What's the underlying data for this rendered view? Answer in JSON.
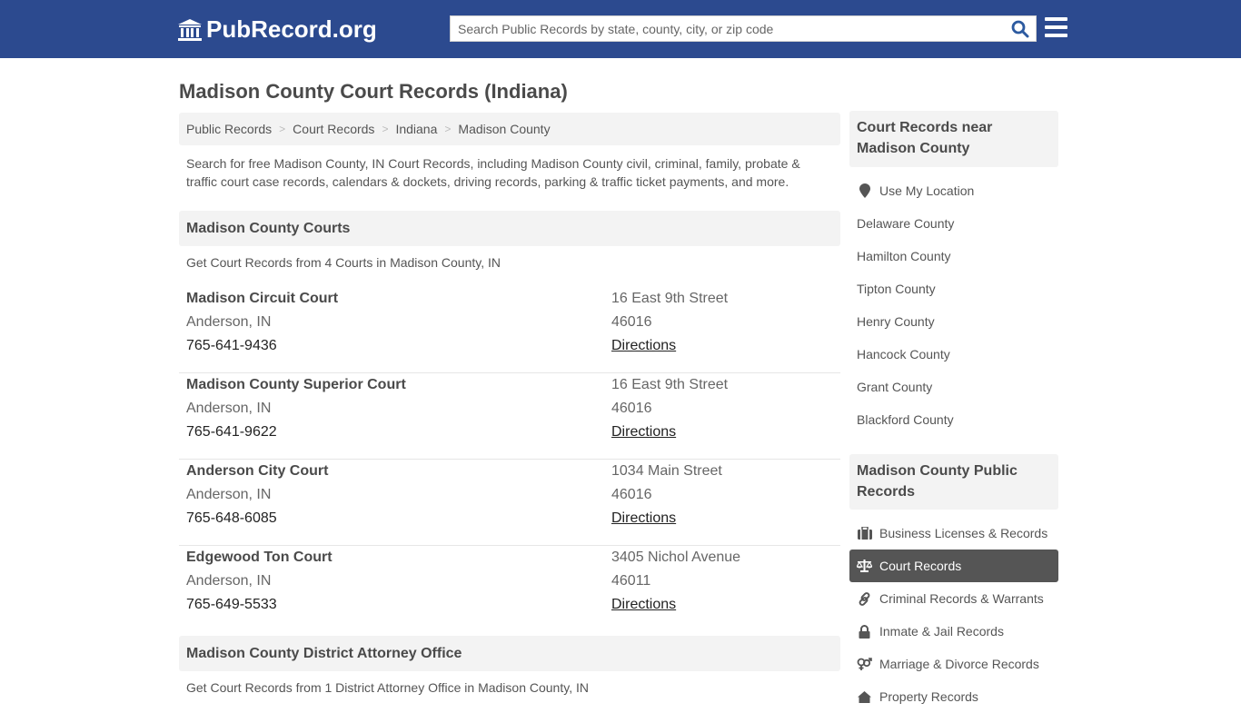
{
  "header": {
    "logo_text": "PubRecord.org",
    "search_placeholder": "Search Public Records by state, county, city, or zip code"
  },
  "page_title": "Madison County Court Records (Indiana)",
  "breadcrumb": [
    "Public Records",
    "Court Records",
    "Indiana",
    "Madison County"
  ],
  "breadcrumb_separator": ">",
  "intro": "Search for free Madison County, IN Court Records, including Madison County civil, criminal, family, probate & traffic court case records, calendars & dockets, driving records, parking & traffic ticket payments, and more.",
  "courts_section": {
    "title": "Madison County Courts",
    "subtitle": "Get Court Records from 4 Courts in Madison County, IN",
    "courts": [
      {
        "name": "Madison Circuit Court",
        "city": "Anderson, IN",
        "phone": "765-641-9436",
        "address": "16 East 9th Street",
        "zip": "46016",
        "directions": "Directions"
      },
      {
        "name": "Madison County Superior Court",
        "city": "Anderson, IN",
        "phone": "765-641-9622",
        "address": "16 East 9th Street",
        "zip": "46016",
        "directions": "Directions"
      },
      {
        "name": "Anderson City Court",
        "city": "Anderson, IN",
        "phone": "765-648-6085",
        "address": "1034 Main Street",
        "zip": "46016",
        "directions": "Directions"
      },
      {
        "name": "Edgewood Ton Court",
        "city": "Anderson, IN",
        "phone": "765-649-5533",
        "address": "3405 Nichol Avenue",
        "zip": "46011",
        "directions": "Directions"
      }
    ]
  },
  "da_section": {
    "title": "Madison County District Attorney Office",
    "subtitle": "Get Court Records from 1 District Attorney Office in Madison County, IN"
  },
  "sidebar": {
    "nearby_title": "Court Records near Madison County",
    "use_location": "Use My Location",
    "nearby": [
      "Delaware County",
      "Hamilton County",
      "Tipton County",
      "Henry County",
      "Hancock County",
      "Grant County",
      "Blackford County"
    ],
    "public_title": "Madison County Public Records",
    "public_links": [
      {
        "label": "Business Licenses & Records",
        "icon": "briefcase-icon",
        "active": false
      },
      {
        "label": "Court Records",
        "icon": "scales-icon",
        "active": true
      },
      {
        "label": "Criminal Records & Warrants",
        "icon": "link-icon",
        "active": false
      },
      {
        "label": "Inmate & Jail Records",
        "icon": "lock-icon",
        "active": false
      },
      {
        "label": "Marriage & Divorce Records",
        "icon": "venus-mars-icon",
        "active": false
      },
      {
        "label": "Property Records",
        "icon": "home-icon",
        "active": false
      }
    ]
  },
  "colors": {
    "header_bg": "#2c4a8f",
    "search_icon": "#2c5aa0",
    "active_bg": "#555555",
    "panel_bg": "#f3f3f3"
  }
}
